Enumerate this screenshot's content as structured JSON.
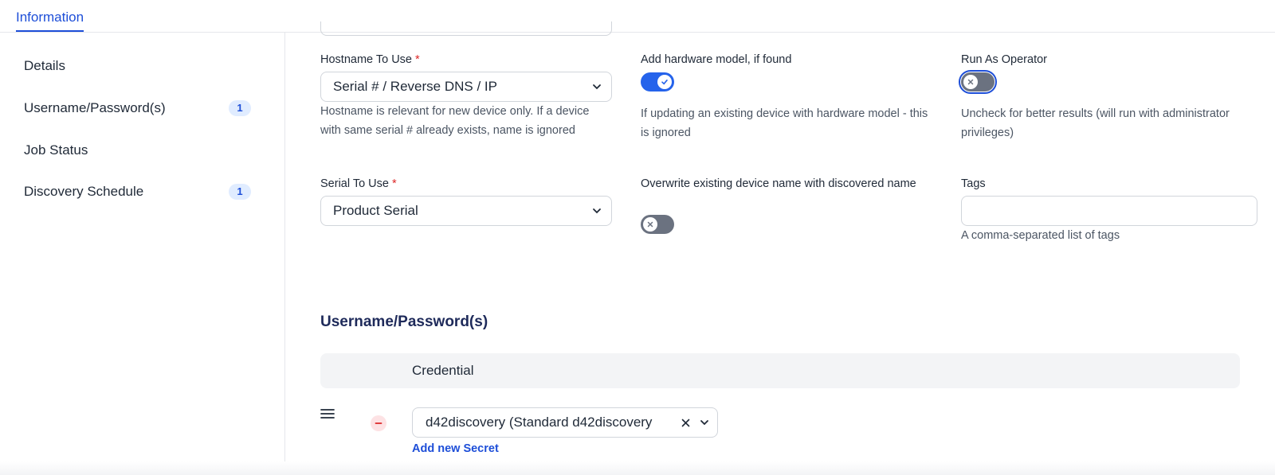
{
  "tabs": {
    "active": "Information"
  },
  "sidebar": {
    "items": [
      {
        "label": "Details",
        "badge": ""
      },
      {
        "label": "Username/Password(s)",
        "badge": "1"
      },
      {
        "label": "Job Status",
        "badge": ""
      },
      {
        "label": "Discovery Schedule",
        "badge": "1"
      }
    ]
  },
  "form": {
    "hostname": {
      "label": "Hostname To Use",
      "required_mark": "*",
      "value": "Serial # / Reverse DNS / IP",
      "help": "Hostname is relevant for new device only. If a device with same serial # already exists, name is ignored"
    },
    "hardware_model": {
      "label": "Add hardware model, if found",
      "checked": true,
      "help": "If updating an existing device with hardware model - this is ignored"
    },
    "run_as_operator": {
      "label": "Run As Operator",
      "checked": false,
      "help": "Uncheck for better results (will run with administrator privileges)"
    },
    "serial": {
      "label": "Serial To Use",
      "required_mark": "*",
      "value": "Product Serial"
    },
    "overwrite_name": {
      "label": "Overwrite existing device name with discovered name",
      "checked": false
    },
    "tags": {
      "label": "Tags",
      "value": "",
      "help": "A comma-separated list of tags"
    }
  },
  "credentials_section": {
    "title": "Username/Password(s)",
    "column_header": "Credential",
    "rows": [
      {
        "value": "d42discovery (Standard d42discovery"
      }
    ],
    "add_link": "Add new Secret"
  },
  "colors": {
    "accent": "#2563eb",
    "toggle_off": "#6b7280",
    "required": "#dc2626",
    "section_title": "#1e2a5a"
  }
}
